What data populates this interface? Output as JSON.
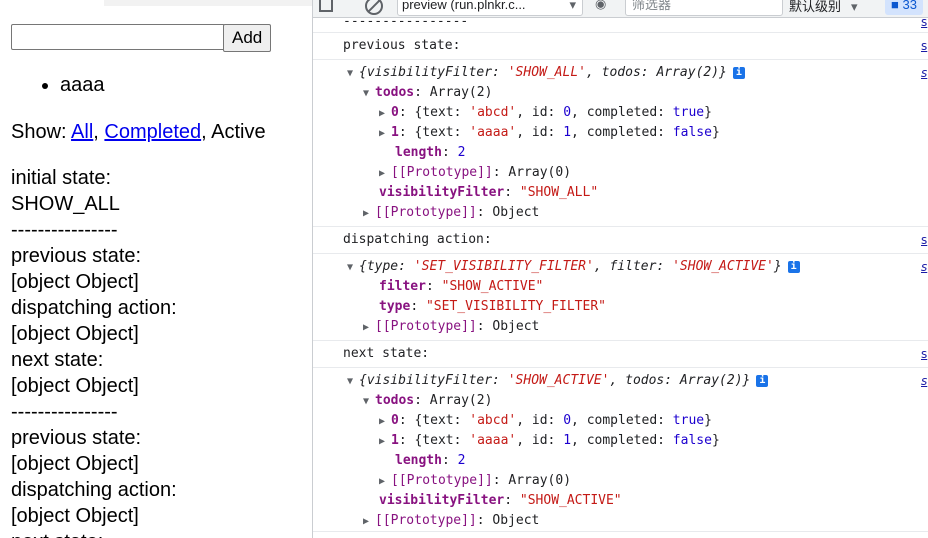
{
  "left": {
    "input_value": "",
    "add_label": "Add",
    "todos": [
      "aaaa"
    ],
    "show_prefix": "Show: ",
    "filter_all": "All",
    "filter_completed": "Completed",
    "filter_active": "Active",
    "comma": ", ",
    "log_lines": [
      "initial state:",
      "SHOW_ALL",
      "----------------",
      "previous state:",
      "[object Object]",
      "dispatching action:",
      "[object Object]",
      "next state:",
      "[object Object]",
      "----------------",
      "previous state:",
      "[object Object]",
      "dispatching action:",
      "[object Object]",
      "next state:"
    ]
  },
  "devtools": {
    "context": "preview (run.plnkr.c...",
    "filter_placeholder": "筛选器",
    "levels": "默认级别",
    "issues_count": "33",
    "source_link": "s",
    "divider": "----------------",
    "previous_label": "previous state:",
    "dispatch_label": "dispatching action:",
    "next_label": "next state:",
    "prev": {
      "summary_a": "{visibilityFilter: ",
      "summary_filter": "'SHOW_ALL'",
      "summary_b": ", todos: Array(2)}",
      "todos_key": "todos",
      "todos_val": "Array(2)",
      "item0_key": "0",
      "item0_val": "{text: 'abcd', id: 0, completed: true}",
      "item1_key": "1",
      "item1_val": "{text: 'aaaa', id: 1, completed: false}",
      "length_key": "length",
      "length_val": "2",
      "proto_arr_key": "[[Prototype]]",
      "proto_arr_val": "Array(0)",
      "vf_key": "visibilityFilter",
      "vf_val": "\"SHOW_ALL\"",
      "proto_key": "[[Prototype]]",
      "proto_val": "Object"
    },
    "action": {
      "summary_a": "{type: ",
      "summary_type": "'SET_VISIBILITY_FILTER'",
      "summary_b": ", filter: ",
      "summary_filter": "'SHOW_ACTIVE'",
      "summary_c": "}",
      "filter_key": "filter",
      "filter_val": "\"SHOW_ACTIVE\"",
      "type_key": "type",
      "type_val": "\"SET_VISIBILITY_FILTER\"",
      "proto_key": "[[Prototype]]",
      "proto_val": "Object"
    },
    "next": {
      "summary_a": "{visibilityFilter: ",
      "summary_filter": "'SHOW_ACTIVE'",
      "summary_b": ", todos: Array(2)}",
      "todos_key": "todos",
      "todos_val": "Array(2)",
      "item0_key": "0",
      "item0_val": "{text: 'abcd', id: 0, completed: true}",
      "item1_key": "1",
      "item1_val": "{text: 'aaaa', id: 1, completed: false}",
      "length_key": "length",
      "length_val": "2",
      "proto_arr_key": "[[Prototype]]",
      "proto_arr_val": "Array(0)",
      "vf_key": "visibilityFilter",
      "vf_val": "\"SHOW_ACTIVE\"",
      "proto_key": "[[Prototype]]",
      "proto_val": "Object"
    }
  }
}
